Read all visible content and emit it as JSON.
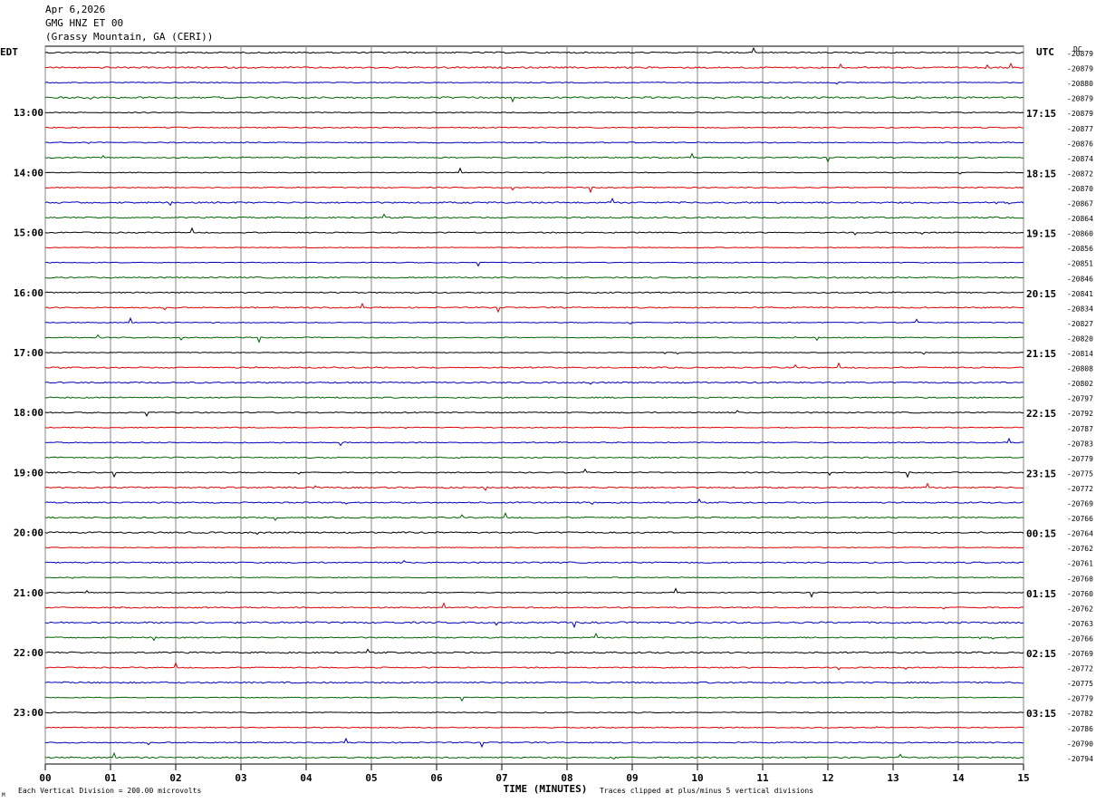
{
  "header": {
    "date": "Apr 6,2026",
    "station": "GMG HNZ ET 00",
    "location": "(Grassy Mountain, GA (CERI))"
  },
  "chart_data": {
    "type": "line",
    "title": "GMG HNZ ET 00",
    "left_axis_label": "EDT",
    "right_axis_label": "UTC",
    "dc_label": "DC",
    "xlabel": "TIME (MINUTES)",
    "x_ticks": [
      "00",
      "01",
      "02",
      "03",
      "04",
      "05",
      "06",
      "07",
      "08",
      "09",
      "10",
      "11",
      "12",
      "13",
      "14",
      "15"
    ],
    "xlim": [
      0,
      15
    ],
    "trace_colors": [
      "#000000",
      "#e00000",
      "#0000c0",
      "#006400"
    ],
    "edt_hour_labels": [
      "13:00",
      "14:00",
      "15:00",
      "16:00",
      "17:00",
      "18:00",
      "19:00",
      "20:00",
      "21:00",
      "22:00",
      "23:00"
    ],
    "utc_hour_labels": [
      "17:15",
      "18:15",
      "19:15",
      "20:15",
      "21:15",
      "22:15",
      "23:15",
      "00:15",
      "01:15",
      "02:15",
      "03:15"
    ],
    "dc_offsets": [
      "-20879",
      "-20879",
      "-20880",
      "-20879",
      "-20879",
      "-20877",
      "-20876",
      "-20874",
      "-20872",
      "-20870",
      "-20867",
      "-20864",
      "-20860",
      "-20856",
      "-20851",
      "-20846",
      "-20841",
      "-20834",
      "-20827",
      "-20820",
      "-20814",
      "-20808",
      "-20802",
      "-20797",
      "-20792",
      "-20787",
      "-20783",
      "-20779",
      "-20775",
      "-20772",
      "-20769",
      "-20766",
      "-20764",
      "-20762",
      "-20761",
      "-20760",
      "-20760",
      "-20762",
      "-20763",
      "-20766",
      "-20769",
      "-20772",
      "-20775",
      "-20779",
      "-20782",
      "-20786",
      "-20790",
      "-20794"
    ],
    "footer_left": "Each Vertical Division =  200.00 microvolts",
    "footer_right": "Traces clipped at plus/minus 5 vertical divisions",
    "footer_mark": "M"
  }
}
